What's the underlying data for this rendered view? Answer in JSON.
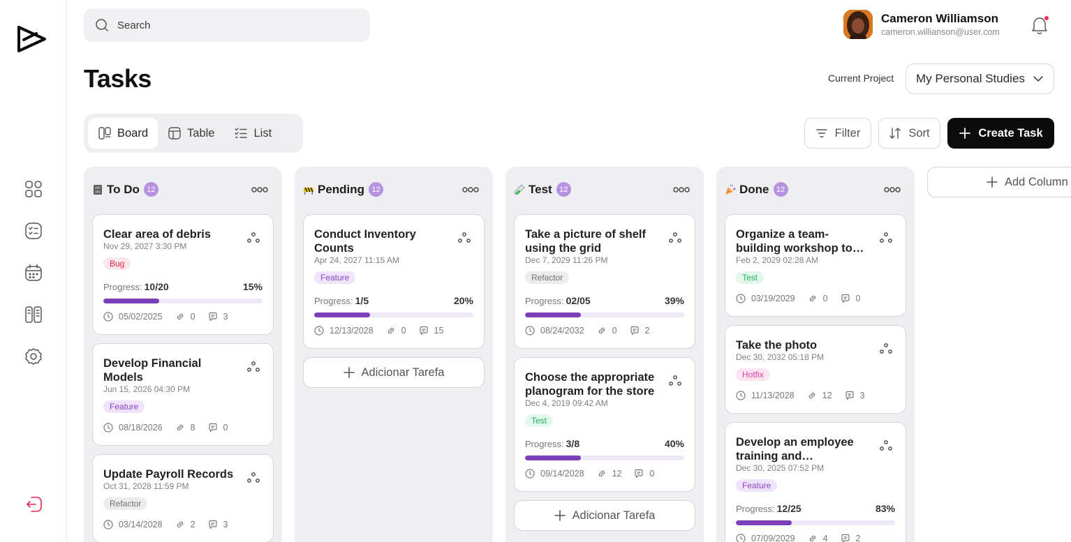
{
  "search": {
    "placeholder": "Search"
  },
  "user": {
    "name": "Cameron Williamson",
    "email": "cameron.willianson@user.com"
  },
  "page": {
    "title": "Tasks"
  },
  "project": {
    "label": "Current Project",
    "value": "My Personal Studies"
  },
  "views": [
    {
      "label": "Board",
      "active": true
    },
    {
      "label": "Table",
      "active": false
    },
    {
      "label": "List",
      "active": false
    }
  ],
  "toolbar": {
    "filter": "Filter",
    "sort": "Sort",
    "create": "Create Task",
    "add_column": "Add Column",
    "add_task": "Adicionar Tarefa"
  },
  "progress_label": "Progress:",
  "columns": [
    {
      "title": "To Do",
      "emoji": "file-cabinet-icon",
      "count": "12",
      "cards": [
        {
          "title": "Clear area of debris",
          "date": "Nov 29, 2027 3:30 PM",
          "tag": "Bug",
          "progress": "10/20",
          "pct": "15%",
          "fill": 0.35,
          "due": "05/02/2025",
          "links": "0",
          "comments": "3"
        },
        {
          "title": "Develop Financial Models",
          "date": "Jun 15, 2026 04:30 PM",
          "tag": "Feature",
          "due": "08/18/2026",
          "links": "8",
          "comments": "0"
        },
        {
          "title": "Update Payroll Records",
          "date": "Oct 31, 2028 11:59 PM",
          "tag": "Refactor",
          "due": "03/14/2028",
          "links": "2",
          "comments": "3"
        }
      ]
    },
    {
      "title": "Pending",
      "emoji": "construction-icon",
      "count": "12",
      "cards": [
        {
          "title": "Conduct Inventory Counts",
          "date": "Apr 24, 2027 11:15 AM",
          "tag": "Feature",
          "progress": "1/5",
          "pct": "20%",
          "fill": 0.35,
          "due": "12/13/2028",
          "links": "0",
          "comments": "15"
        }
      ]
    },
    {
      "title": "Test",
      "emoji": "test-tube-icon",
      "count": "12",
      "cards": [
        {
          "title": "Take a picture of shelf using the grid",
          "date": "Dec 7, 2029 11:26 PM",
          "tag": "Refactor",
          "progress": "02/05",
          "pct": "39%",
          "fill": 0.35,
          "due": "08/24/2032",
          "links": "0",
          "comments": "2"
        },
        {
          "title": "Choose the appropriate planogram for the store",
          "date": "Dec 4, 2019 09:42 AM",
          "tag": "Test",
          "progress": "3/8",
          "pct": "40%",
          "fill": 0.35,
          "due": "09/14/2028",
          "links": "12",
          "comments": "0"
        }
      ]
    },
    {
      "title": "Done",
      "emoji": "party-popper-icon",
      "count": "12",
      "cards": [
        {
          "title": "Organize a team-building workshop to improve morale",
          "date": "Feb 2, 2029 02:28 AM",
          "tag": "Test",
          "due": "03/19/2029",
          "links": "0",
          "comments": "0"
        },
        {
          "title": "Take the photo",
          "date": "Dec 30, 2032 05:18 PM",
          "tag": "Hotfix",
          "due": "11/13/2028",
          "links": "12",
          "comments": "3"
        },
        {
          "title": "Develop an employee training and development plan",
          "date": "Dec 30, 2025 07:52 PM",
          "tag": "Feature",
          "progress": "12/25",
          "pct": "83%",
          "fill": 0.35,
          "due": "07/09/2029",
          "links": "4",
          "comments": "2"
        }
      ]
    }
  ],
  "colors": {
    "accent": "#7b3fb8",
    "count_badge": "#b693e0",
    "primary": "#0b0b0b",
    "notification": "#ff2d55",
    "logout": "#e0284d"
  }
}
